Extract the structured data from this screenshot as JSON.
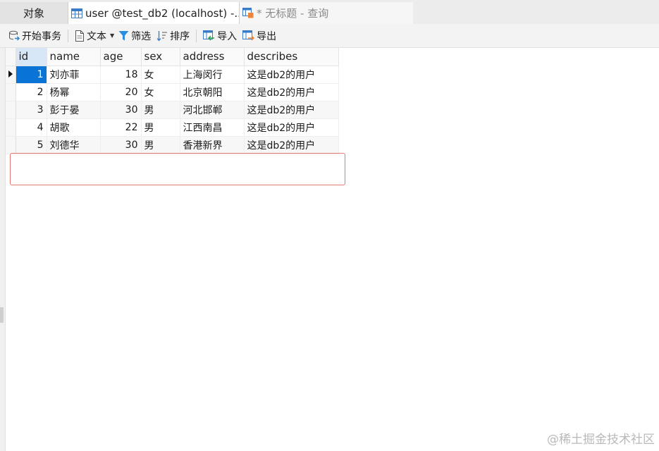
{
  "tabs": {
    "objects": "对象",
    "table": "user @test_db2 (localhost) -...",
    "query": "* 无标题 - 查询"
  },
  "toolbar": {
    "begin_transaction": "开始事务",
    "text": "文本",
    "filter": "筛选",
    "sort": "排序",
    "import": "导入",
    "export": "导出"
  },
  "grid": {
    "columns": [
      "id",
      "name",
      "age",
      "sex",
      "address",
      "describes"
    ],
    "rows": [
      {
        "id": "1",
        "name": "刘亦菲",
        "age": "18",
        "sex": "女",
        "address": "上海闵行",
        "describes": "这是db2的用户"
      },
      {
        "id": "2",
        "name": "杨幂",
        "age": "20",
        "sex": "女",
        "address": "北京朝阳",
        "describes": "这是db2的用户"
      },
      {
        "id": "3",
        "name": "彭于晏",
        "age": "30",
        "sex": "男",
        "address": "河北邯郸",
        "describes": "这是db2的用户"
      },
      {
        "id": "4",
        "name": "胡歌",
        "age": "22",
        "sex": "男",
        "address": "江西南昌",
        "describes": "这是db2的用户"
      },
      {
        "id": "5",
        "name": "刘德华",
        "age": "30",
        "sex": "男",
        "address": "香港新界",
        "describes": "这是db2的用户"
      }
    ]
  },
  "watermark": "@稀土掘金技术社区",
  "colors": {
    "selection": "#0a74d6",
    "highlight_border": "#e57a74"
  }
}
